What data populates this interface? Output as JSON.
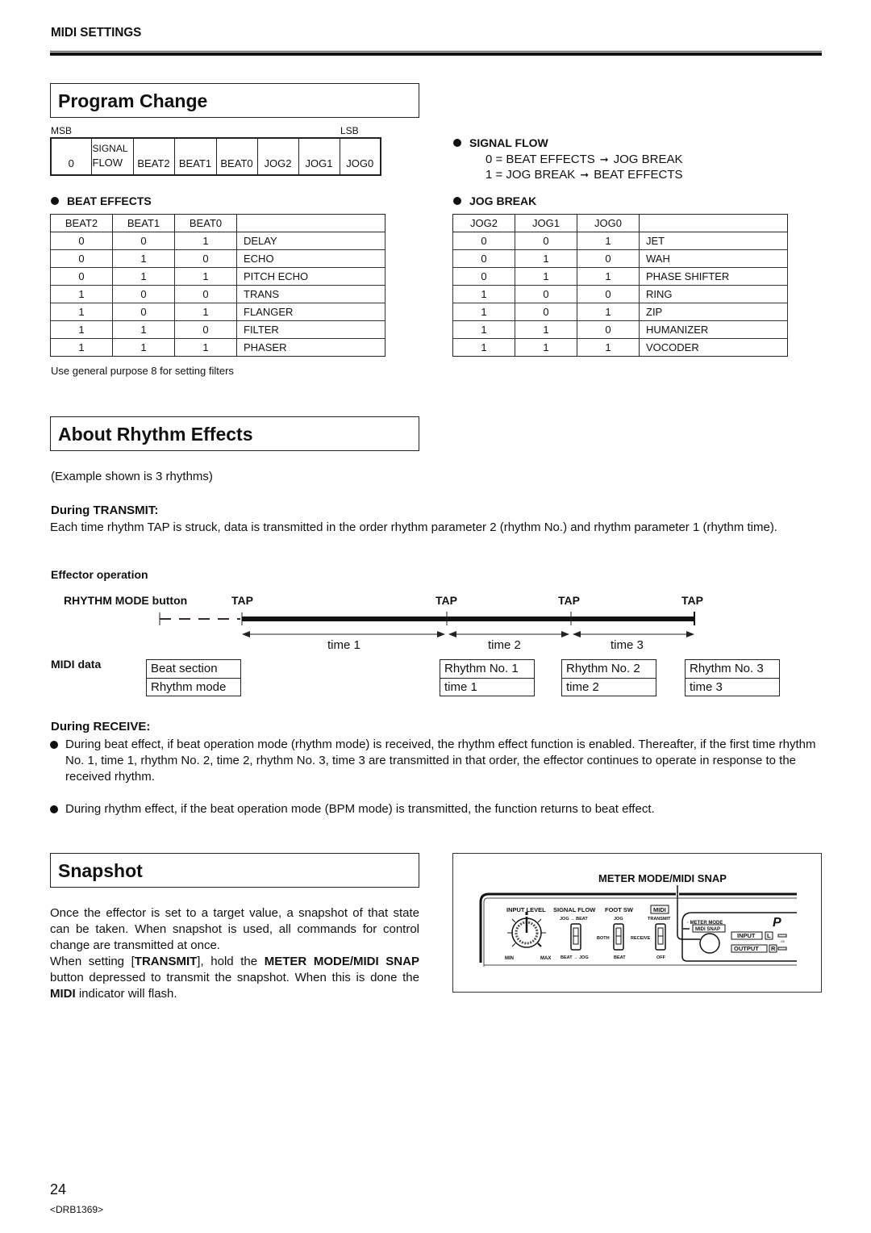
{
  "header": {
    "section": "MIDI SETTINGS"
  },
  "program_change": {
    "title": "Program Change",
    "msb_label": "MSB",
    "lsb_label": "LSB",
    "byte_cells": [
      "0",
      "SIGNAL|FLOW",
      "BEAT2",
      "BEAT1",
      "BEAT0",
      "JOG2",
      "JOG1",
      "JOG0"
    ],
    "byte_signal_top": "SIGNAL",
    "byte_signal_bottom": "FLOW",
    "signal_flow": {
      "heading": "SIGNAL FLOW",
      "lines": [
        {
          "prefix": "0 = BEAT EFFECTS",
          "suffix": "JOG BREAK"
        },
        {
          "prefix": "1 = JOG BREAK",
          "suffix": "BEAT EFFECTS"
        }
      ],
      "arrow": "➞"
    },
    "beat_effects": {
      "heading": "BEAT EFFECTS",
      "columns": [
        "BEAT2",
        "BEAT1",
        "BEAT0",
        ""
      ],
      "rows": [
        [
          "0",
          "0",
          "1",
          "DELAY"
        ],
        [
          "0",
          "1",
          "0",
          "ECHO"
        ],
        [
          "0",
          "1",
          "1",
          "PITCH ECHO"
        ],
        [
          "1",
          "0",
          "0",
          "TRANS"
        ],
        [
          "1",
          "0",
          "1",
          "FLANGER"
        ],
        [
          "1",
          "1",
          "0",
          "FILTER"
        ],
        [
          "1",
          "1",
          "1",
          "PHASER"
        ]
      ],
      "note": "Use general purpose 8 for setting filters"
    },
    "jog_break": {
      "heading": "JOG BREAK",
      "columns": [
        "JOG2",
        "JOG1",
        "JOG0",
        ""
      ],
      "rows": [
        [
          "0",
          "0",
          "1",
          "JET"
        ],
        [
          "0",
          "1",
          "0",
          "WAH"
        ],
        [
          "0",
          "1",
          "1",
          "PHASE SHIFTER"
        ],
        [
          "1",
          "0",
          "0",
          "RING"
        ],
        [
          "1",
          "0",
          "1",
          "ZIP"
        ],
        [
          "1",
          "1",
          "0",
          "HUMANIZER"
        ],
        [
          "1",
          "1",
          "1",
          "VOCODER"
        ]
      ]
    }
  },
  "rhythm_effects": {
    "title": "About Rhythm Effects",
    "example_note": "(Example shown is 3 rhythms)",
    "transmit": {
      "heading": "During TRANSMIT:",
      "text": "Each time rhythm TAP is struck, data is transmitted in the order rhythm parameter 2 (rhythm No.) and rhythm parameter 1 (rhythm time)."
    },
    "diagram": {
      "effector_label": "Effector operation",
      "rhythm_mode_label": "RHYTHM MODE button",
      "tap_label": "TAP",
      "time_labels": [
        "time 1",
        "time 2",
        "time 3"
      ],
      "midi_data_label": "MIDI data",
      "midi_boxes": [
        {
          "top": "Beat section",
          "bottom": "Rhythm mode"
        },
        {
          "top": "Rhythm No. 1",
          "bottom": "time 1"
        },
        {
          "top": "Rhythm No. 2",
          "bottom": "time 2"
        },
        {
          "top": "Rhythm No. 3",
          "bottom": "time 3"
        }
      ]
    },
    "receive": {
      "heading": "During RECEIVE:",
      "bullets": [
        "During beat effect, if beat operation mode (rhythm mode) is received, the rhythm effect function is enabled. Thereafter, if the first time rhythm No. 1, time 1, rhythm No. 2, time 2, rhythm No. 3, time 3 are transmitted in that order, the effector continues to operate in response to the received rhythm.",
        "During rhythm effect, if the beat operation mode (BPM mode) is transmitted, the function returns to beat effect."
      ]
    }
  },
  "snapshot": {
    "title": "Snapshot",
    "p1": "Once the effector is set to a target value, a snapshot of that state can be taken. When snapshot is used, all commands for control change are transmitted at once.",
    "p2_a": "When setting [",
    "p2_b": "TRANSMIT",
    "p2_c": "], hold the ",
    "p2_d": "METER MODE/MIDI SNAP",
    "p2_e": " button depressed to transmit the snapshot. When this is done the ",
    "p2_f": "MIDI",
    "p2_g": " indicator will flash.",
    "panel": {
      "callout": "METER MODE/MIDI SNAP",
      "input_level": "INPUT LEVEL",
      "min": "MIN",
      "max": "MAX",
      "signal_flow": "SIGNAL FLOW",
      "sf_top": "JOG → BEAT",
      "sf_bottom": "BEAT → JOG",
      "foot_sw": "FOOT SW",
      "fs_top": "JOG",
      "fs_mid": "BOTH",
      "fs_bottom": "BEAT",
      "midi": "MIDI",
      "midi_top": "TRANSMIT",
      "midi_mid": "RECEIVE",
      "midi_bottom": "OFF",
      "meter_mode": "METER MODE",
      "midi_snap": "MIDI SNAP",
      "input": "INPUT",
      "output": "OUTPUT",
      "l": "L",
      "r": "R",
      "db": "-15",
      "brand_partial": "P"
    }
  },
  "footer": {
    "page_number": "24",
    "doc_code": "<DRB1369>"
  }
}
